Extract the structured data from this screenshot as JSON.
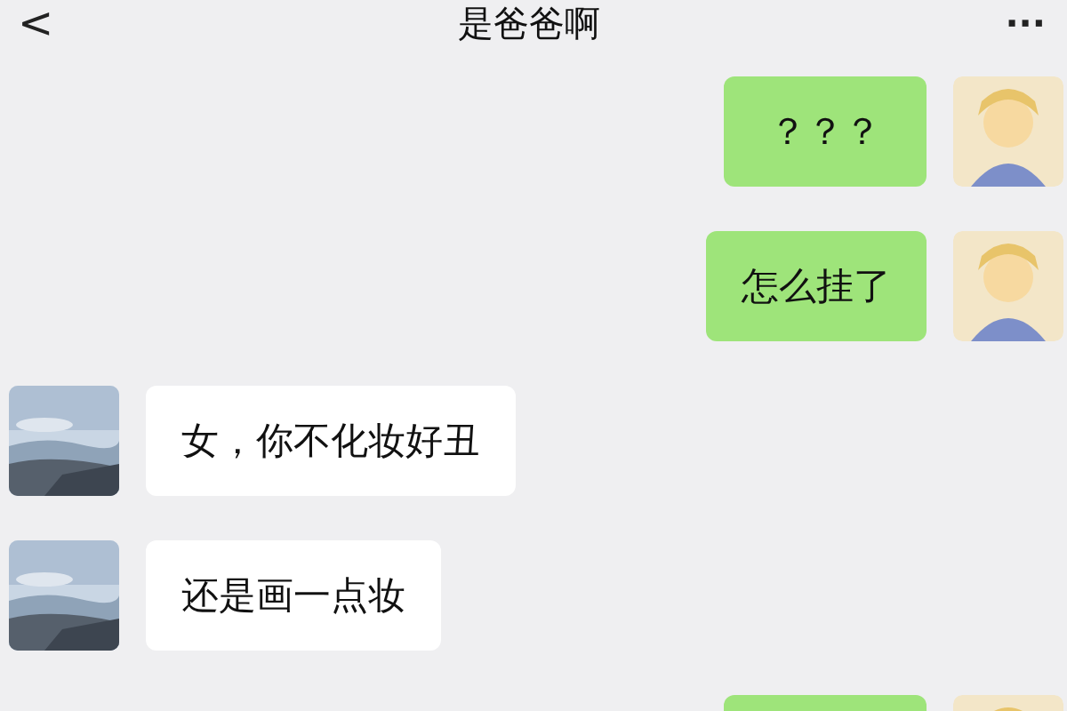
{
  "header": {
    "back": "<",
    "title": "是爸爸啊",
    "more": "···"
  },
  "messages": [
    {
      "kind": "outgoing",
      "text": "？？？"
    },
    {
      "kind": "outgoing",
      "text": "怎么挂了"
    },
    {
      "kind": "incoming",
      "text": "女，你不化妆好丑"
    },
    {
      "kind": "incoming",
      "text": "还是画一点妆"
    },
    {
      "kind": "outgoing"
    }
  ]
}
